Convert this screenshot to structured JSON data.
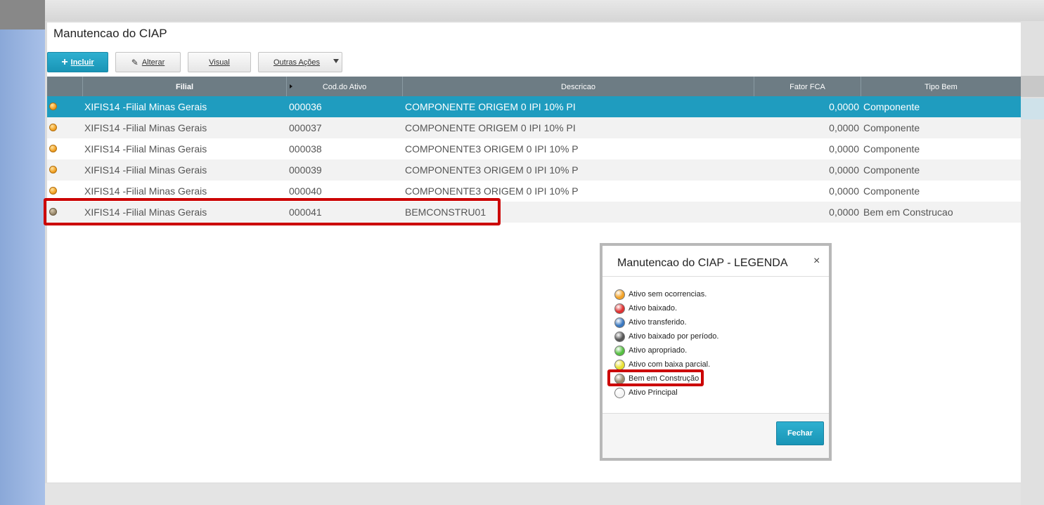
{
  "page": {
    "title": "Manutencao do CIAP"
  },
  "toolbar": {
    "incluir": "Incluir",
    "alterar": "Alterar",
    "visual": "Visual",
    "outras": "Outras Ações"
  },
  "grid": {
    "headers": [
      "",
      "Filial",
      "Cod.do Ativo",
      "Descricao",
      "Fator FCA",
      "Tipo Bem"
    ],
    "rows": [
      {
        "status": "orange",
        "filial": "XIFIS14 -Filial Minas Gerais",
        "cod": "000036",
        "desc": "COMPONENTE ORIGEM 0 IPI 10% PI",
        "fator": "0,0000",
        "tipo": "Componente"
      },
      {
        "status": "orange",
        "filial": "XIFIS14 -Filial Minas Gerais",
        "cod": "000037",
        "desc": "COMPONENTE ORIGEM 0 IPI 10% PI",
        "fator": "0,0000",
        "tipo": "Componente"
      },
      {
        "status": "orange",
        "filial": "XIFIS14 -Filial Minas Gerais",
        "cod": "000038",
        "desc": "COMPONENTE3 ORIGEM 0 IPI 10% P",
        "fator": "0,0000",
        "tipo": "Componente"
      },
      {
        "status": "orange",
        "filial": "XIFIS14 -Filial Minas Gerais",
        "cod": "000039",
        "desc": "COMPONENTE3 ORIGEM 0 IPI 10% P",
        "fator": "0,0000",
        "tipo": "Componente"
      },
      {
        "status": "orange",
        "filial": "XIFIS14 -Filial Minas Gerais",
        "cod": "000040",
        "desc": "COMPONENTE3 ORIGEM 0 IPI 10% P",
        "fator": "0,0000",
        "tipo": "Componente"
      },
      {
        "status": "tan",
        "filial": "XIFIS14 -Filial Minas Gerais",
        "cod": "000041",
        "desc": "BEMCONSTRU01",
        "fator": "0,0000",
        "tipo": "Bem em Construcao"
      }
    ]
  },
  "modal": {
    "title": "Manutencao do CIAP - LEGENDA",
    "close": "×",
    "items": [
      {
        "label": "Ativo sem ocorrencias.",
        "color": "#f2a226"
      },
      {
        "label": "Ativo baixado.",
        "color": "#e03030"
      },
      {
        "label": "Ativo transferido.",
        "color": "#3a78c0"
      },
      {
        "label": "Ativo baixado por período.",
        "color": "#555555"
      },
      {
        "label": "Ativo apropriado.",
        "color": "#55c040"
      },
      {
        "label": "Ativo com baixa parcial.",
        "color": "#e8e030"
      },
      {
        "label": "Bem em Construção",
        "color": "#9a8a6e"
      },
      {
        "label": "Ativo Principal",
        "color": "#f4f4f4"
      }
    ],
    "fechar": "Fechar"
  }
}
